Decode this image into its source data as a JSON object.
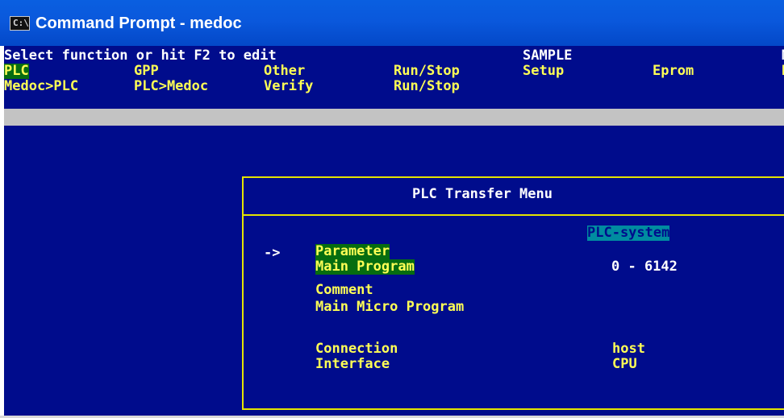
{
  "window": {
    "icon_text": "C:\\",
    "title": "Command Prompt - medoc"
  },
  "header": {
    "prompt": "Select function or hit F2 to edit",
    "project": "SAMPLE",
    "project_right": "M",
    "menu_selected": "PLC",
    "menu_right": "H",
    "menu": [
      "GPP",
      "Other",
      "Run/Stop",
      "Setup",
      "Eprom"
    ],
    "submenu": [
      "Medoc>PLC",
      "PLC>Medoc",
      "Verify",
      "Run/Stop"
    ]
  },
  "dialog": {
    "title": "PLC Transfer Menu",
    "system_label": "PLC-system",
    "cursor": "->",
    "items": [
      {
        "label": "Parameter",
        "highlighted": true
      },
      {
        "label": "Main Program",
        "highlighted": true
      },
      {
        "label": "Comment",
        "highlighted": false
      },
      {
        "label": "Main Micro Program",
        "highlighted": false
      }
    ],
    "range": "0 - 6142",
    "connection_label": "Connection",
    "connection_value": "host",
    "interface_label": "Interface",
    "interface_value": "CPU"
  },
  "colors": {
    "console_bg": "#000c8c",
    "text_yellow": "#ffff55",
    "highlight_green": "#066d10",
    "border_yellow": "#e4e400",
    "selection_cyan": "#008ca0"
  }
}
